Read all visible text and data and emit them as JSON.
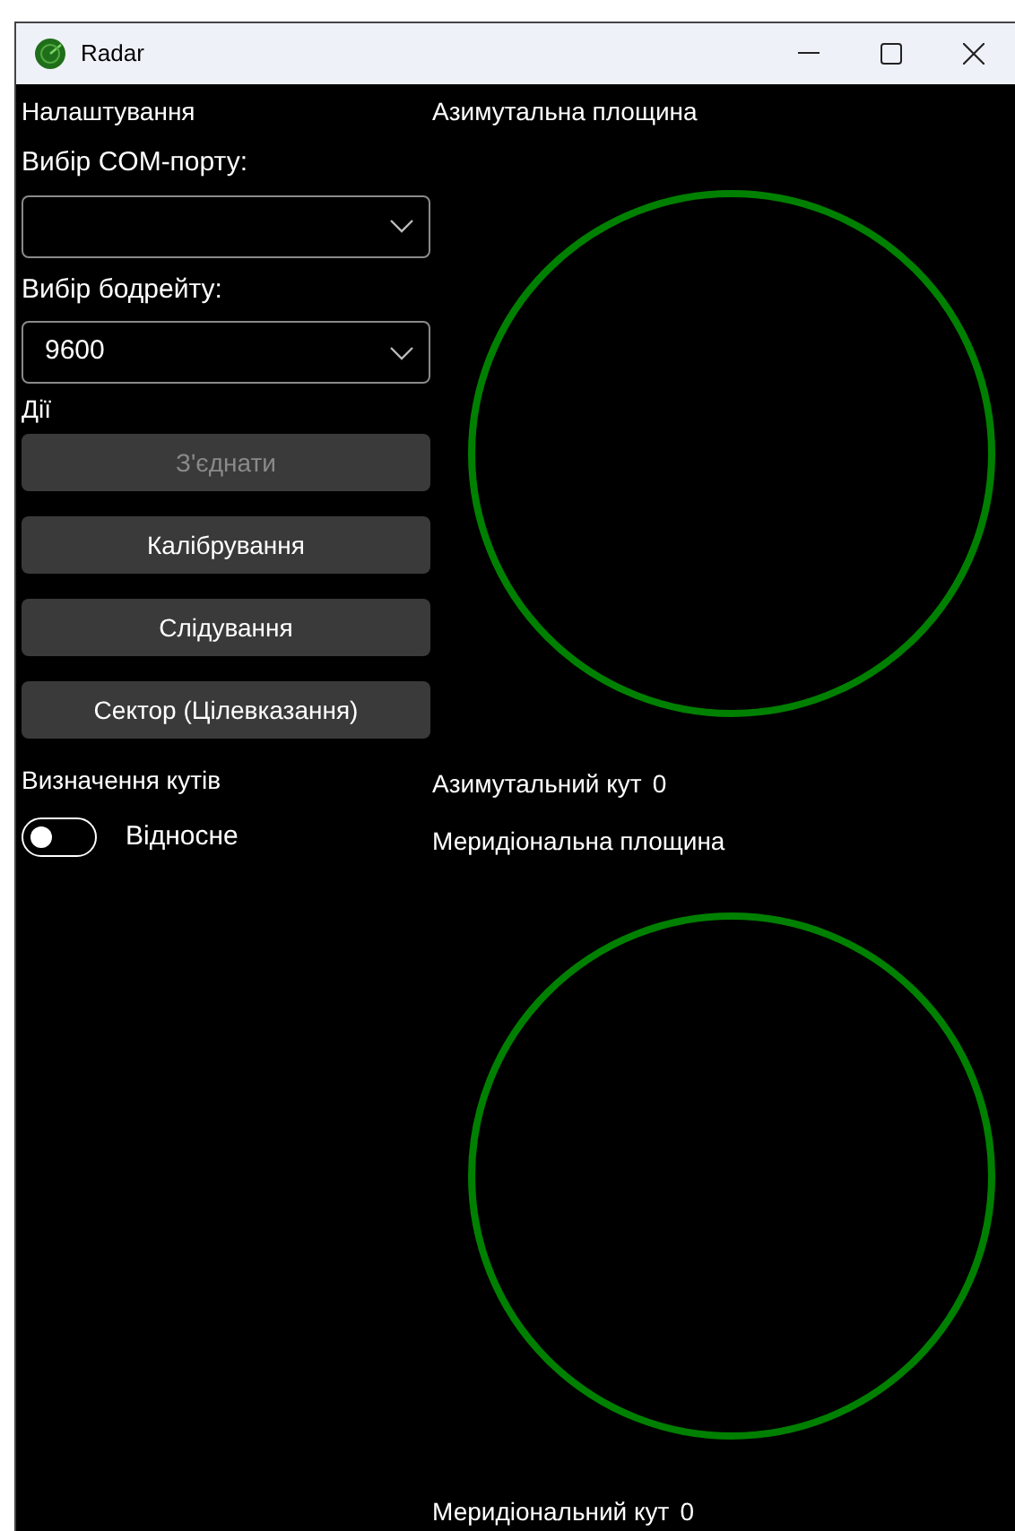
{
  "window": {
    "title": "Radar"
  },
  "settings": {
    "heading": "Налаштування",
    "port_label": "Вибір COM-порту:",
    "baud_label": "Вибір бодрейту:",
    "baud_value": "9600"
  },
  "actions": {
    "heading": "Дії",
    "buttons": [
      {
        "label": "З'єднати",
        "disabled": true
      },
      {
        "label": "Калібрування",
        "disabled": false
      },
      {
        "label": "Слідування",
        "disabled": false
      },
      {
        "label": "Сектор (Цілевказання)",
        "disabled": false
      }
    ]
  },
  "angles": {
    "heading": "Визначення кутів",
    "toggle": {
      "label": "Відносне",
      "on": false
    }
  },
  "azimuth": {
    "title": "Азимутальна площина",
    "angle_label": "Азимутальний кут",
    "angle_value": "0"
  },
  "meridian": {
    "title": "Меридіональна площина",
    "angle_label": "Меридіональний кут",
    "angle_value": "0"
  }
}
